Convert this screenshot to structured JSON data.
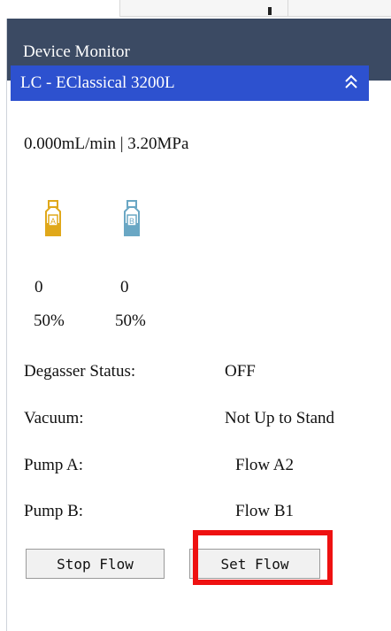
{
  "panel": {
    "title": "Device Monitor"
  },
  "device": {
    "name": "LC - EClassical 3200L",
    "collapse_icon": "double-chevron-up-icon"
  },
  "status": {
    "line": "0.000mL/min | 3.20MPa"
  },
  "solvents": [
    {
      "label": "A",
      "value": "0",
      "percent": "50%",
      "color": "#e0a81a",
      "icon": "solvent-bottle-icon"
    },
    {
      "label": "B",
      "value": "0",
      "percent": "50%",
      "color": "#6aa7c4",
      "icon": "solvent-bottle-icon"
    }
  ],
  "info_rows": [
    {
      "label": "Degasser Status:",
      "value": "OFF"
    },
    {
      "label": "Vacuum:",
      "value": "Not Up to Stand"
    },
    {
      "label": "Pump A:",
      "value": "Flow A2"
    },
    {
      "label": "Pump B:",
      "value": "Flow B1"
    }
  ],
  "buttons": {
    "stop_flow": "Stop Flow",
    "set_flow": "Set Flow"
  },
  "colors": {
    "header_bg": "#3b4a63",
    "device_bar_bg": "#2d51cf",
    "highlight": "#ee1111"
  }
}
